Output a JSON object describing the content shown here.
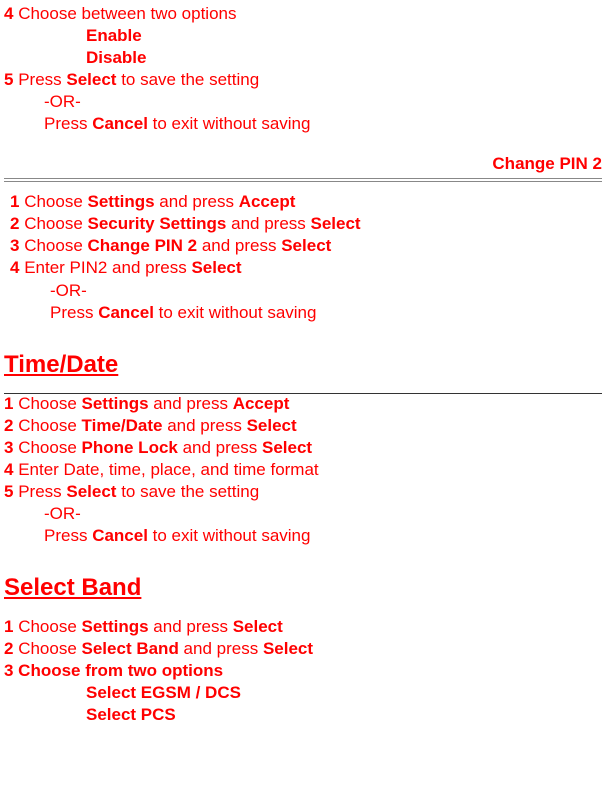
{
  "top": {
    "line1_num": "4 ",
    "line1_rest": "Choose between two options",
    "opt1": "Enable",
    "opt2": "Disable",
    "line2_num": "5 ",
    "line2_a": "Press ",
    "line2_b": "Select",
    "line2_c": " to save the setting",
    "or": "-OR-",
    "line3_a": "Press ",
    "line3_b": "Cancel",
    "line3_c": " to exit without saving"
  },
  "changepin": {
    "heading": "Change PIN 2",
    "l1_num": "1 ",
    "l1_a": "Choose ",
    "l1_b": "Settings",
    "l1_c": " and press ",
    "l1_d": "Accept",
    "l2_num": "2 ",
    "l2_a": "Choose ",
    "l2_b": "Security Settings",
    "l2_c": " and press ",
    "l2_d": "Select",
    "l3_num": "3 ",
    "l3_a": "Choose ",
    "l3_b": "Change PIN 2",
    "l3_c": " and press ",
    "l3_d": "Select",
    "l4_num": "4 ",
    "l4_a": "Enter PIN2 and press ",
    "l4_b": "Select",
    "or": "-OR-",
    "l5_a": "Press ",
    "l5_b": "Cancel",
    "l5_c": " to exit without saving"
  },
  "timedate": {
    "heading": "Time/Date",
    "l1_num": "1 ",
    "l1_a": "Choose ",
    "l1_b": "Settings",
    "l1_c": " and press ",
    "l1_d": "Accept",
    "l2_num": "2 ",
    "l2_a": "Choose ",
    "l2_b": "Time/Date",
    "l2_c": " and press ",
    "l2_d": "Select",
    "l3_num": "3 ",
    "l3_a": "Choose ",
    "l3_b": "Phone Lock",
    "l3_c": " and press ",
    "l3_d": "Select",
    "l4_num": "4 ",
    "l4_a": "Enter Date, time, place, and time format",
    "l5_num": "5 ",
    "l5_a": "Press ",
    "l5_b": "Select",
    "l5_c": " to save the setting",
    "or": "-OR-",
    "l6_a": "Press ",
    "l6_b": "Cancel",
    "l6_c": " to exit without saving"
  },
  "selectband": {
    "heading": "Select Band",
    "l1_num": "1 ",
    "l1_a": "Choose ",
    "l1_b": "Settings",
    "l1_c": " and press ",
    "l1_d": "Select",
    "l2_num": "2 ",
    "l2_a": "Choose ",
    "l2_b": "Select Band",
    "l2_c": " and press ",
    "l2_d": "Select",
    "l3": "3 Choose from two options",
    "opt1": "Select EGSM / DCS",
    "opt2": "Select PCS"
  }
}
